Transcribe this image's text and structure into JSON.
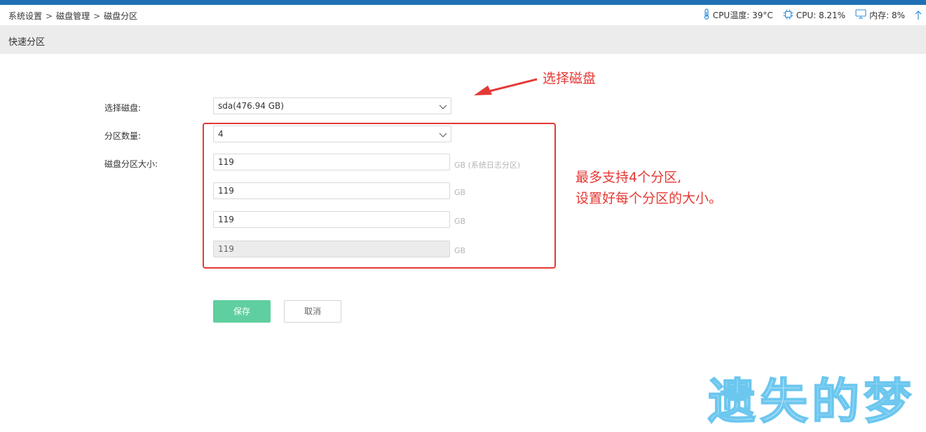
{
  "breadcrumb": {
    "items": [
      "系统设置",
      "磁盘管理",
      "磁盘分区"
    ],
    "separator": ">"
  },
  "status": {
    "cpu_temp": "CPU温度: 39°C",
    "cpu": "CPU: 8.21%",
    "memory": "内存: 8%",
    "icons": [
      "thermometer-icon",
      "cpu-chip-icon",
      "monitor-icon",
      "arrow-up-icon"
    ]
  },
  "section": {
    "title": "快速分区"
  },
  "form": {
    "disk_label": "选择磁盘:",
    "disk_value": "sda(476.94 GB)",
    "count_label": "分区数量:",
    "count_value": "4",
    "size_label": "磁盘分区大小:",
    "partitions": [
      {
        "value": "119",
        "unit": "GB (系统日志分区)",
        "disabled": false
      },
      {
        "value": "119",
        "unit": "GB",
        "disabled": false
      },
      {
        "value": "119",
        "unit": "GB",
        "disabled": false
      },
      {
        "value": "119",
        "unit": "GB",
        "disabled": true
      }
    ]
  },
  "buttons": {
    "save": "保存",
    "cancel": "取消"
  },
  "annotations": {
    "select_disk": "选择磁盘",
    "line1": "最多支持4个分区,",
    "line2": "设置好每个分区的大小。"
  },
  "watermark": "遗失的梦",
  "colors": {
    "top_bar": "#1f6fb5",
    "annotation_red": "#e53935",
    "save_green": "#5fcf9f",
    "watermark_blue": "#6cc7ef"
  }
}
